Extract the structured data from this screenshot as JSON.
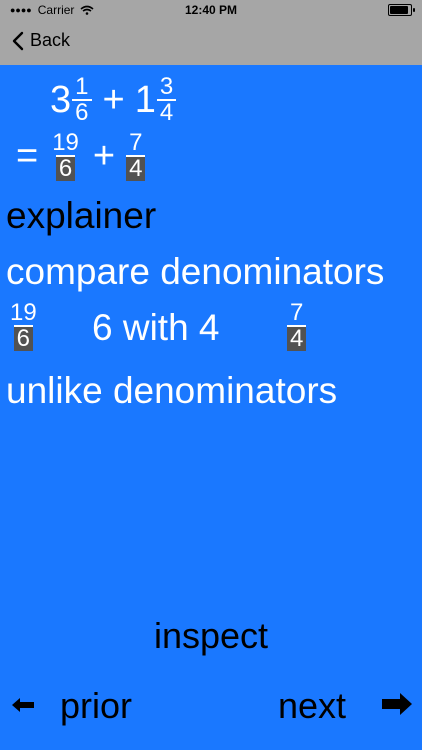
{
  "status": {
    "carrier": "Carrier",
    "time": "12:40 PM"
  },
  "nav": {
    "back_label": "Back"
  },
  "expression": {
    "first_whole": "3",
    "first_num": "1",
    "first_den": "6",
    "op": "+",
    "second_whole": "1",
    "second_num": "3",
    "second_den": "4"
  },
  "improper": {
    "eq": "=",
    "a_num": "19",
    "a_den": "6",
    "op": "+",
    "b_num": "7",
    "b_den": "4"
  },
  "explain": {
    "line1": "explainer",
    "line2": "compare denominators",
    "compare_left_num": "19",
    "compare_left_den": "6",
    "compare_text": "6 with 4",
    "compare_right_num": "7",
    "compare_right_den": "4",
    "line4": "unlike denominators"
  },
  "actions": {
    "inspect": "inspect",
    "prior": "prior",
    "next": "next"
  },
  "colors": {
    "background": "#1a78ff",
    "bar": "#a6a6a6",
    "fraction_box": "#525252"
  }
}
